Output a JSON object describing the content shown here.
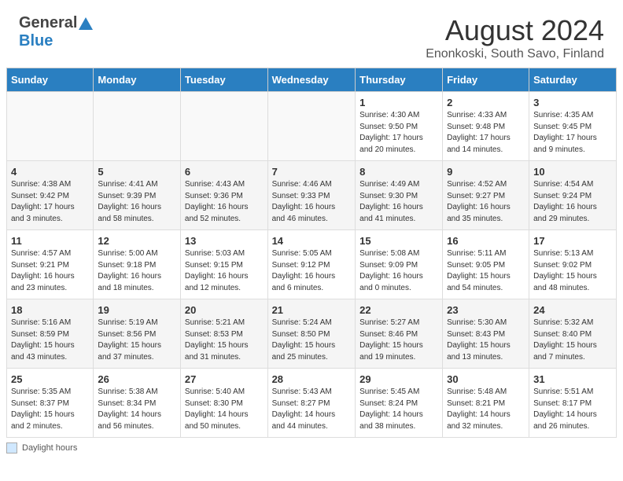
{
  "header": {
    "logo_general": "General",
    "logo_blue": "Blue",
    "main_title": "August 2024",
    "subtitle": "Enonkoski, South Savo, Finland"
  },
  "calendar": {
    "days_of_week": [
      "Sunday",
      "Monday",
      "Tuesday",
      "Wednesday",
      "Thursday",
      "Friday",
      "Saturday"
    ],
    "weeks": [
      [
        {
          "day": "",
          "info": ""
        },
        {
          "day": "",
          "info": ""
        },
        {
          "day": "",
          "info": ""
        },
        {
          "day": "",
          "info": ""
        },
        {
          "day": "1",
          "info": "Sunrise: 4:30 AM\nSunset: 9:50 PM\nDaylight: 17 hours\nand 20 minutes."
        },
        {
          "day": "2",
          "info": "Sunrise: 4:33 AM\nSunset: 9:48 PM\nDaylight: 17 hours\nand 14 minutes."
        },
        {
          "day": "3",
          "info": "Sunrise: 4:35 AM\nSunset: 9:45 PM\nDaylight: 17 hours\nand 9 minutes."
        }
      ],
      [
        {
          "day": "4",
          "info": "Sunrise: 4:38 AM\nSunset: 9:42 PM\nDaylight: 17 hours\nand 3 minutes."
        },
        {
          "day": "5",
          "info": "Sunrise: 4:41 AM\nSunset: 9:39 PM\nDaylight: 16 hours\nand 58 minutes."
        },
        {
          "day": "6",
          "info": "Sunrise: 4:43 AM\nSunset: 9:36 PM\nDaylight: 16 hours\nand 52 minutes."
        },
        {
          "day": "7",
          "info": "Sunrise: 4:46 AM\nSunset: 9:33 PM\nDaylight: 16 hours\nand 46 minutes."
        },
        {
          "day": "8",
          "info": "Sunrise: 4:49 AM\nSunset: 9:30 PM\nDaylight: 16 hours\nand 41 minutes."
        },
        {
          "day": "9",
          "info": "Sunrise: 4:52 AM\nSunset: 9:27 PM\nDaylight: 16 hours\nand 35 minutes."
        },
        {
          "day": "10",
          "info": "Sunrise: 4:54 AM\nSunset: 9:24 PM\nDaylight: 16 hours\nand 29 minutes."
        }
      ],
      [
        {
          "day": "11",
          "info": "Sunrise: 4:57 AM\nSunset: 9:21 PM\nDaylight: 16 hours\nand 23 minutes."
        },
        {
          "day": "12",
          "info": "Sunrise: 5:00 AM\nSunset: 9:18 PM\nDaylight: 16 hours\nand 18 minutes."
        },
        {
          "day": "13",
          "info": "Sunrise: 5:03 AM\nSunset: 9:15 PM\nDaylight: 16 hours\nand 12 minutes."
        },
        {
          "day": "14",
          "info": "Sunrise: 5:05 AM\nSunset: 9:12 PM\nDaylight: 16 hours\nand 6 minutes."
        },
        {
          "day": "15",
          "info": "Sunrise: 5:08 AM\nSunset: 9:09 PM\nDaylight: 16 hours\nand 0 minutes."
        },
        {
          "day": "16",
          "info": "Sunrise: 5:11 AM\nSunset: 9:05 PM\nDaylight: 15 hours\nand 54 minutes."
        },
        {
          "day": "17",
          "info": "Sunrise: 5:13 AM\nSunset: 9:02 PM\nDaylight: 15 hours\nand 48 minutes."
        }
      ],
      [
        {
          "day": "18",
          "info": "Sunrise: 5:16 AM\nSunset: 8:59 PM\nDaylight: 15 hours\nand 43 minutes."
        },
        {
          "day": "19",
          "info": "Sunrise: 5:19 AM\nSunset: 8:56 PM\nDaylight: 15 hours\nand 37 minutes."
        },
        {
          "day": "20",
          "info": "Sunrise: 5:21 AM\nSunset: 8:53 PM\nDaylight: 15 hours\nand 31 minutes."
        },
        {
          "day": "21",
          "info": "Sunrise: 5:24 AM\nSunset: 8:50 PM\nDaylight: 15 hours\nand 25 minutes."
        },
        {
          "day": "22",
          "info": "Sunrise: 5:27 AM\nSunset: 8:46 PM\nDaylight: 15 hours\nand 19 minutes."
        },
        {
          "day": "23",
          "info": "Sunrise: 5:30 AM\nSunset: 8:43 PM\nDaylight: 15 hours\nand 13 minutes."
        },
        {
          "day": "24",
          "info": "Sunrise: 5:32 AM\nSunset: 8:40 PM\nDaylight: 15 hours\nand 7 minutes."
        }
      ],
      [
        {
          "day": "25",
          "info": "Sunrise: 5:35 AM\nSunset: 8:37 PM\nDaylight: 15 hours\nand 2 minutes."
        },
        {
          "day": "26",
          "info": "Sunrise: 5:38 AM\nSunset: 8:34 PM\nDaylight: 14 hours\nand 56 minutes."
        },
        {
          "day": "27",
          "info": "Sunrise: 5:40 AM\nSunset: 8:30 PM\nDaylight: 14 hours\nand 50 minutes."
        },
        {
          "day": "28",
          "info": "Sunrise: 5:43 AM\nSunset: 8:27 PM\nDaylight: 14 hours\nand 44 minutes."
        },
        {
          "day": "29",
          "info": "Sunrise: 5:45 AM\nSunset: 8:24 PM\nDaylight: 14 hours\nand 38 minutes."
        },
        {
          "day": "30",
          "info": "Sunrise: 5:48 AM\nSunset: 8:21 PM\nDaylight: 14 hours\nand 32 minutes."
        },
        {
          "day": "31",
          "info": "Sunrise: 5:51 AM\nSunset: 8:17 PM\nDaylight: 14 hours\nand 26 minutes."
        }
      ]
    ]
  },
  "footer": {
    "daylight_label": "Daylight hours"
  }
}
